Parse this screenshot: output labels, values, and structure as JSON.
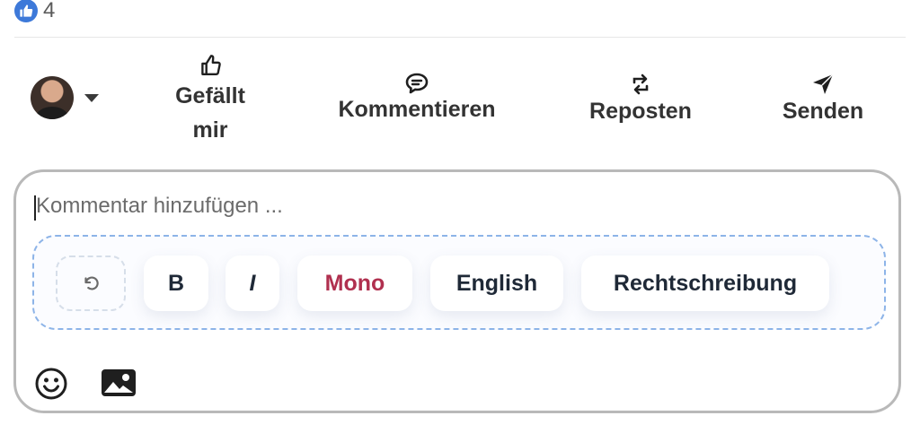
{
  "reactions": {
    "icon": "thumbs-up-icon",
    "count": "4"
  },
  "actions": {
    "like_label": "Gefällt mir",
    "comment_label": "Kommentieren",
    "repost_label": "Reposten",
    "send_label": "Senden"
  },
  "comment": {
    "placeholder": "Kommentar hinzufügen ..."
  },
  "toolbar": {
    "undo_icon": "undo-icon",
    "bold_label": "B",
    "italic_label": "I",
    "mono_label": "Mono",
    "english_label": "English",
    "spelling_label": "Rechtschreibung"
  },
  "attachments": {
    "emoji_icon": "smiley-icon",
    "image_icon": "image-icon"
  },
  "colors": {
    "like_blue": "#3d79d9",
    "mono_red": "#b0304f",
    "toolbar_border": "#8db4e8"
  }
}
